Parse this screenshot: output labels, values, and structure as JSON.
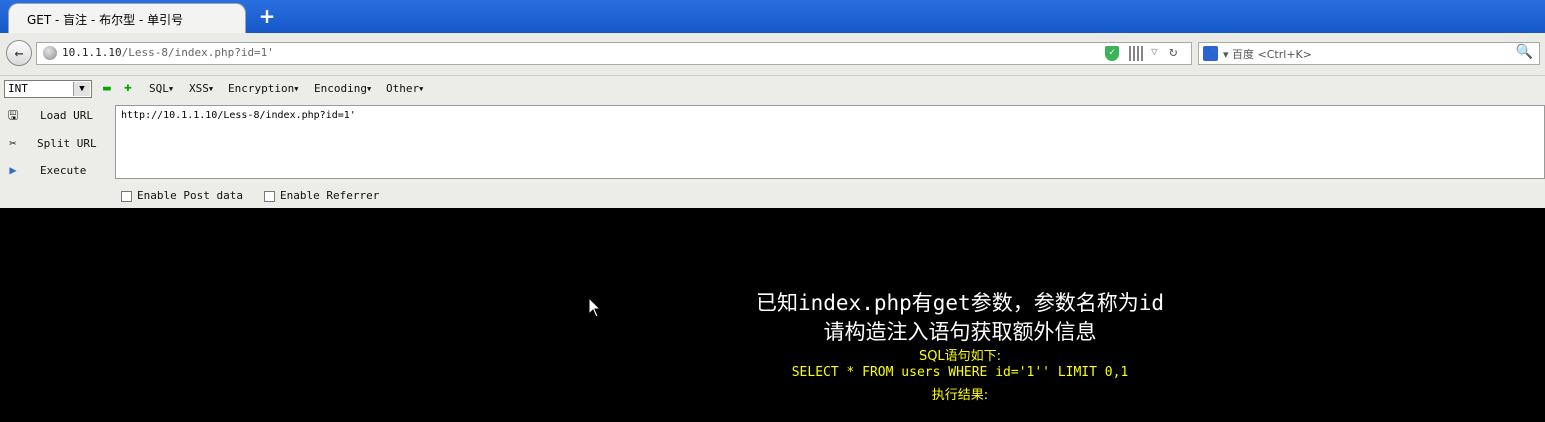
{
  "tabs": [
    {
      "title": "GET - 盲注 - 布尔型 - 单引号"
    }
  ],
  "new_tab_label": "+",
  "navbar": {
    "url_host": "10.1.1.10",
    "url_path": "/Less-8/index.php?id=1'",
    "search_placeholder": "百度 <Ctrl+K>"
  },
  "hackbar": {
    "select_value": "INT",
    "menus": [
      "SQL",
      "XSS",
      "Encryption",
      "Encoding",
      "Other"
    ],
    "actions": {
      "load": "Load URL",
      "split": "Split URL",
      "execute": "Execute"
    },
    "url_value": "http://10.1.1.10/Less-8/index.php?id=1'",
    "enable_post": "Enable Post data",
    "enable_referrer": "Enable Referrer"
  },
  "page": {
    "line1": "已知index.php有get参数，参数名称为id",
    "line2": "请构造注入语句获取额外信息",
    "line3": "SQL语句如下:",
    "line4": "SELECT * FROM users WHERE id='1'' LIMIT 0,1",
    "line5": "执行结果:"
  },
  "colors": {
    "page_bg": "#000000",
    "info_text": "#ffffff",
    "sql_text": "#ffff00",
    "tabstrip": "#1c5fcf"
  }
}
